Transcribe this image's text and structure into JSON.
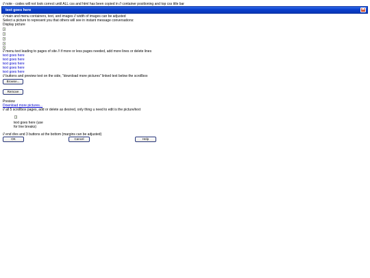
{
  "top_note": "// note - codes will not look correct until ALL css and html has been copied in // container positioning and top css title bar",
  "window": {
    "title": "text goes here",
    "close_symbol": "✕"
  },
  "notes": {
    "containers": "// main and menu containers, text, and images // width of images can be adjusted",
    "select_picture": "Select a picture to represent you that others will see in instant message conversations:",
    "display_picture": "Display picture",
    "menu_text": "// menu text leading to pages of site // if more or less pages needed, add more lines or delete lines",
    "buttons_preview": "// buttons and preview text on the side, \"download more pictures\" linked text below the scrollbox",
    "preview": "Preview",
    "scrollbox": "// all 5 scrollbox pages, add or delete as desired, only thing u need to edit is the picture/text",
    "end_divs": "// end divs and 3 buttons at the bottom (margins can be adjusted)"
  },
  "menu_items": [
    "text goes here",
    "text goes here",
    "text goes here",
    "text goes here",
    "text goes here"
  ],
  "buttons": {
    "browse": "Browse...",
    "remove": "Remove",
    "ok": "OK",
    "cancel": "Cancel",
    "help": "Help"
  },
  "download_link": "Download more pictures...",
  "scroll_item": {
    "line1": "text goes here (use",
    "line2": "for line breaks)"
  }
}
